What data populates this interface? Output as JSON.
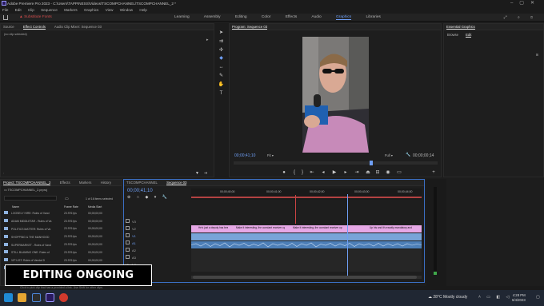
{
  "titlebar": {
    "title": "Adobe Premiere Pro 2023 - C:\\Users\\TAPPINESS\\Videos\\TSCOMPCHANNEL\\TSCOMPCHANNEL_2 *"
  },
  "menubar": {
    "items": [
      "File",
      "Edit",
      "Clip",
      "Sequence",
      "Markers",
      "Graphics",
      "View",
      "Window",
      "Help"
    ]
  },
  "workspace": {
    "warning": "Substitute Fonts",
    "tabs": [
      "Learning",
      "Assembly",
      "Editing",
      "Color",
      "Effects",
      "Audio",
      "Graphics",
      "Libraries"
    ],
    "active_tab": "Graphics"
  },
  "source_panel": {
    "tabs": [
      "Source",
      "Effect Controls",
      "Audio Clip Mixer: Sequence 03"
    ],
    "active_tab": "Effect Controls",
    "empty_text": "(no clip selected)"
  },
  "program_monitor": {
    "title": "Program: Sequence 03",
    "timecode": "00;00;41;10",
    "fit": "Fit",
    "quality": "Full",
    "duration": "00;00;00;14"
  },
  "essential_graphics": {
    "title": "Essential Graphics",
    "tabs": [
      "Browse",
      "Edit"
    ],
    "active_tab": "Edit"
  },
  "project_panel": {
    "tabs": [
      "Project: TSCOMPCHANNEL_2",
      "Effects",
      "Markers",
      "History"
    ],
    "active_tab": "Project: TSCOMPCHANNEL_2",
    "path": "TSCOMPCHANNEL_2.prproj",
    "items_count": "1 of 16 items selected",
    "columns": [
      "Name",
      "Frame Rate",
      "Media Start"
    ],
    "rows": [
      {
        "name": "LOOSELY HIRE: Rules of Vand",
        "rate": "23.976 fps",
        "start": "00;00;00;00"
      },
      {
        "name": "ADAM MIDDLETAR - Rules of Va",
        "rate": "23.976 fps",
        "start": "00;00;00;00"
      },
      {
        "name": "POLITICS MATTER: Rules of Va",
        "rate": "23.976 fps",
        "start": "00;00;00;00"
      },
      {
        "name": "SHOPPING & THE MANHOOD",
        "rate": "23.976 fps",
        "start": "00;00;00;00"
      },
      {
        "name": "SUPERMARKET - Rules of Vand",
        "rate": "23.976 fps",
        "start": "00;00;00;00"
      },
      {
        "name": "STILL BLAMING ONE: Rules of",
        "rate": "23.976 fps",
        "start": "00;00;00;00"
      },
      {
        "name": "VIP LIST: Rules of Vandal D",
        "rate": "23.976 fps",
        "start": "00;00;00;00"
      },
      {
        "name": "SHABBOT BARRETTO: TABA",
        "rate": "23.976 fps",
        "start": "00;00;00;00"
      }
    ]
  },
  "timeline": {
    "tabs": [
      "TSCOMPCHANNEL",
      "Sequence 03"
    ],
    "active_tab": "Sequence 03",
    "timecode": "00;00;41;10",
    "ruler": [
      "00;00;40;00",
      "00;00;41;00",
      "00;00;42;00",
      "00;00;43;00",
      "00;00;44;00",
      "00;00;45;00"
    ],
    "tracks": [
      "V3",
      "V2",
      "V1",
      "A1",
      "A2",
      "A3",
      "Mix"
    ],
    "caption_clips": [
      "He's just a deputy has been waiting for a buzzer",
      "Make it interesting, the constant receiver up",
      "Make it interesting, the constant receiver up",
      "Up his and it's exactly mandatory and"
    ],
    "mix_value": "0.0"
  },
  "overlay": {
    "caption": "EDITING ONGOING"
  },
  "statusbar": {
    "text": "Click to pick clip that has a provided a link. Use Shift for other clips."
  },
  "taskbar": {
    "weather": "28°C",
    "weather_text": "Mostly cloudy",
    "time": "4:28 PM",
    "date": "6/4/2023"
  },
  "colors": {
    "accent": "#6f9ff5",
    "caption_clip": "#e6a8e6",
    "video_clip": "#78a4d8",
    "audio_clip": "#5b8ec3",
    "playhead": "#6f9ff5"
  }
}
